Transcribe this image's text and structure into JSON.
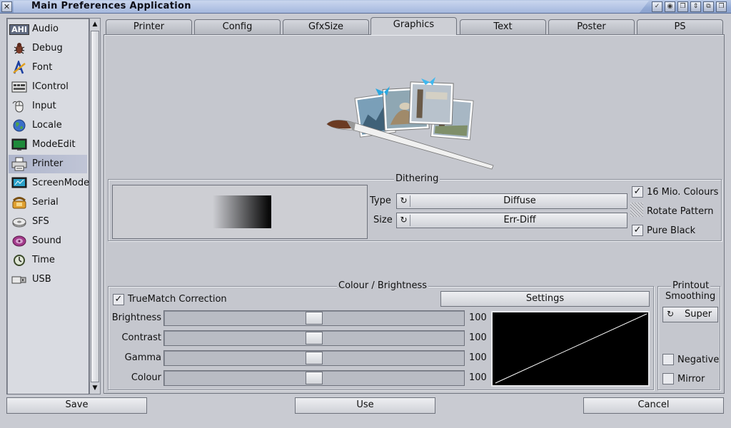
{
  "window": {
    "title": "Main Preferences Application",
    "close_glyph": "✕",
    "gadgets": [
      "✓",
      "◉",
      "❐",
      "⇕",
      "⧉",
      "❐"
    ]
  },
  "sidebar": {
    "items": [
      {
        "label": "Audio",
        "icon": "ahi-icon"
      },
      {
        "label": "Debug",
        "icon": "bug-icon"
      },
      {
        "label": "Font",
        "icon": "font-icon"
      },
      {
        "label": "IControl",
        "icon": "keyboard-icon"
      },
      {
        "label": "Input",
        "icon": "mouse-icon"
      },
      {
        "label": "Locale",
        "icon": "globe-icon"
      },
      {
        "label": "ModeEdit",
        "icon": "monitor-icon"
      },
      {
        "label": "Printer",
        "icon": "printer-icon"
      },
      {
        "label": "ScreenMode",
        "icon": "screen-icon"
      },
      {
        "label": "Serial",
        "icon": "phone-icon"
      },
      {
        "label": "SFS",
        "icon": "disk-icon"
      },
      {
        "label": "Sound",
        "icon": "speaker-icon"
      },
      {
        "label": "Time",
        "icon": "clock-icon"
      },
      {
        "label": "USB",
        "icon": "usb-icon"
      }
    ],
    "selected": "Printer",
    "scroll_up_glyph": "▲",
    "scroll_down_glyph": "▼",
    "ahi_text": "AHI"
  },
  "tabs": [
    "Printer",
    "Config",
    "GfxSize",
    "Graphics",
    "Text",
    "Poster",
    "PS"
  ],
  "active_tab": "Graphics",
  "dithering": {
    "title": "Dithering",
    "type_label": "Type",
    "type_value": "Diffuse",
    "size_label": "Size",
    "size_value": "Err-Diff",
    "mio_colours": {
      "label": "16 Mio. Colours",
      "checked": true
    },
    "rotate_pattern": {
      "label": "Rotate Pattern"
    },
    "pure_black": {
      "label": "Pure Black",
      "checked": true
    },
    "check_glyph": "✓",
    "cycle_glyph": "↻"
  },
  "colour": {
    "title": "Colour / Brightness",
    "truematch": {
      "label": "TrueMatch Correction",
      "checked": true
    },
    "settings_label": "Settings",
    "sliders": [
      {
        "label": "Brightness",
        "value": "100"
      },
      {
        "label": "Contrast",
        "value": "100"
      },
      {
        "label": "Gamma",
        "value": "100"
      },
      {
        "label": "Colour",
        "value": "100"
      }
    ]
  },
  "printout": {
    "title": "Printout",
    "smoothing_label": "Smoothing",
    "smoothing_value": "Super",
    "negative": {
      "label": "Negative",
      "checked": false
    },
    "mirror": {
      "label": "Mirror",
      "checked": false
    }
  },
  "bottom": {
    "save": "Save",
    "use": "Use",
    "cancel": "Cancel"
  }
}
